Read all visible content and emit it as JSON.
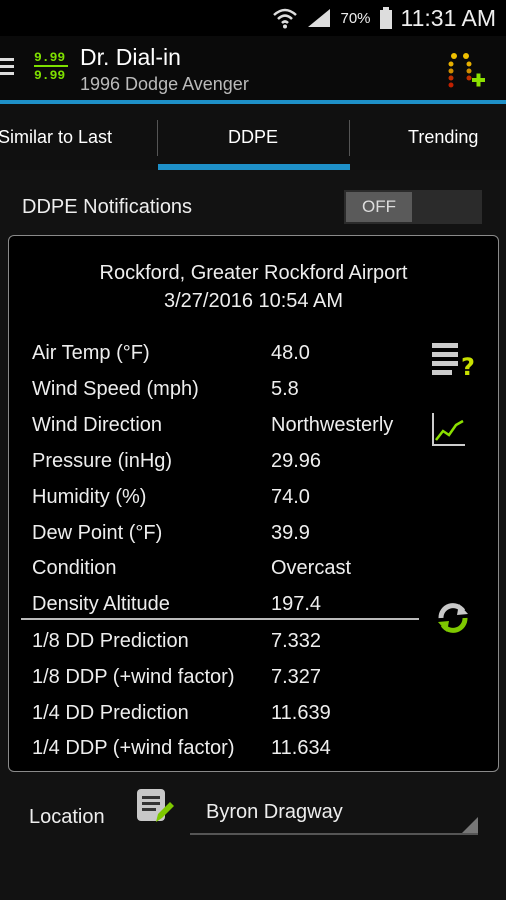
{
  "status_bar": {
    "battery": "70%",
    "time": "11:31 AM"
  },
  "action_bar": {
    "title": "Dr. Dial-in",
    "subtitle": "1996 Dodge Avenger",
    "logo_digits": "9.99"
  },
  "tabs": [
    {
      "label": "Similar to Last"
    },
    {
      "label": "DDPE"
    },
    {
      "label": "Trending"
    }
  ],
  "notifications": {
    "label": "DDPE Notifications",
    "toggle": "OFF"
  },
  "weather": {
    "station": "Rockford, Greater Rockford Airport",
    "datetime": "3/27/2016 10:54 AM",
    "rows": [
      {
        "label": "Air Temp (°F)",
        "value": "48.0"
      },
      {
        "label": "Wind Speed (mph)",
        "value": "5.8"
      },
      {
        "label": "Wind Direction",
        "value": "Northwesterly"
      },
      {
        "label": "Pressure (inHg)",
        "value": "29.96"
      },
      {
        "label": "Humidity (%)",
        "value": "74.0"
      },
      {
        "label": "Dew Point (°F)",
        "value": "39.9"
      },
      {
        "label": "Condition",
        "value": "Overcast"
      },
      {
        "label": "Density Altitude",
        "value": "197.4"
      }
    ],
    "predictions": [
      {
        "label": "1/8 DD Prediction",
        "value": "7.332"
      },
      {
        "label": "1/8 DDP (+wind factor)",
        "value": "7.327"
      },
      {
        "label": "1/4 DD Prediction",
        "value": "11.639"
      },
      {
        "label": "1/4 DDP (+wind factor)",
        "value": "11.634"
      }
    ]
  },
  "location": {
    "label": "Location",
    "selected": "Byron Dragway"
  },
  "colors": {
    "accent": "#1e90c8",
    "logo_green": "#7ee000"
  }
}
